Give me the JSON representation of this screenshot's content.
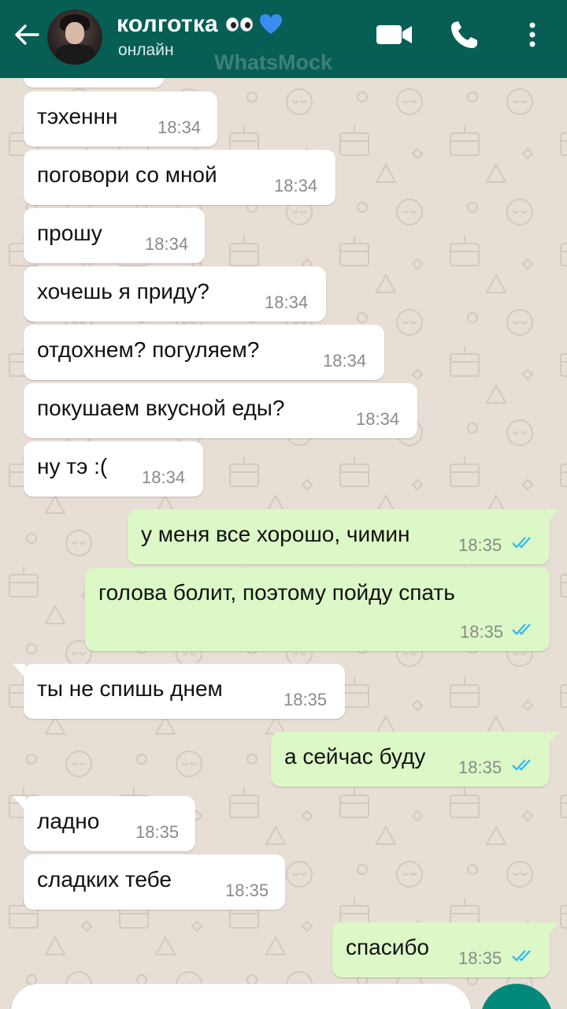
{
  "header": {
    "contact_name": "колготка",
    "status": "онлайн",
    "watermark": "WhatsMock",
    "heart_color": "#3b8cf2"
  },
  "colors": {
    "header": "#075e54",
    "incoming_bubble": "#ffffff",
    "outgoing_bubble": "#dcf8c6",
    "read_ticks": "#34b7f1"
  },
  "messages": [
    {
      "text": "тэхеннн",
      "time": "18:34",
      "dir": "in"
    },
    {
      "text": "поговори со мной",
      "time": "18:34",
      "dir": "in"
    },
    {
      "text": "прошу",
      "time": "18:34",
      "dir": "in"
    },
    {
      "text": "хочешь я приду?",
      "time": "18:34",
      "dir": "in"
    },
    {
      "text": "отдохнем? погуляем?",
      "time": "18:34",
      "dir": "in"
    },
    {
      "text": "покушаем вкусной еды?",
      "time": "18:34",
      "dir": "in"
    },
    {
      "text": "ну тэ :(",
      "time": "18:34",
      "dir": "in"
    },
    {
      "text": "у меня все хорошо, чимин",
      "time": "18:35",
      "dir": "out"
    },
    {
      "text": "голова болит, поэтому пойду спать",
      "time": "18:35",
      "dir": "out"
    },
    {
      "text": "ты не спишь днем",
      "time": "18:35",
      "dir": "in"
    },
    {
      "text": "а сейчас буду",
      "time": "18:35",
      "dir": "out"
    },
    {
      "text": "ладно",
      "time": "18:35",
      "dir": "in"
    },
    {
      "text": "сладких тебе",
      "time": "18:35",
      "dir": "in"
    },
    {
      "text": "спасибо",
      "time": "18:35",
      "dir": "out"
    }
  ]
}
